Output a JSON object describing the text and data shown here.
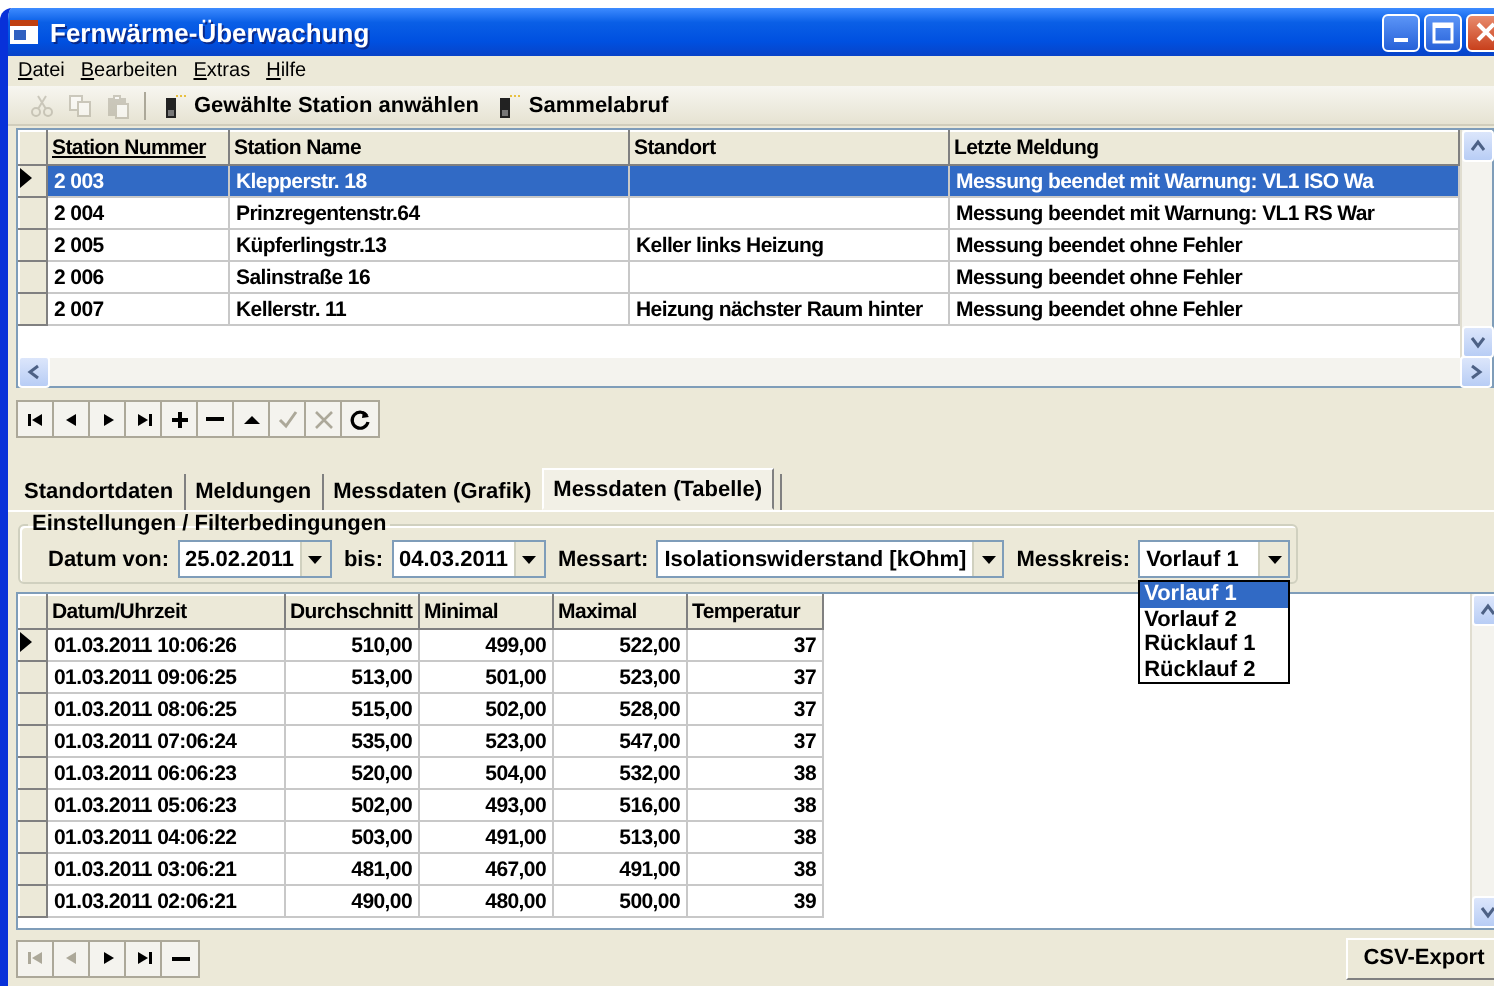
{
  "window": {
    "title": "Fernwärme-Überwachung"
  },
  "menu": [
    "Datei",
    "Bearbeiten",
    "Extras",
    "Hilfe"
  ],
  "toolbar": {
    "edit_buttons": [
      {
        "kind": "cut",
        "disabled": true
      },
      {
        "kind": "copy",
        "disabled": true
      },
      {
        "kind": "paste",
        "disabled": true
      }
    ],
    "buttons": [
      "Gewählte Station anwählen",
      "Sammelabruf"
    ]
  },
  "stations": {
    "columns": [
      "Station Nummer",
      "Station Name",
      "Standort",
      "Letzte Meldung"
    ],
    "rows": [
      {
        "cells": [
          "2 003",
          "Klepperstr. 18",
          "",
          "Messung beendet mit Warnung:  VL1 ISO Wa"
        ],
        "selected": true
      },
      {
        "cells": [
          "2 004",
          "Prinzregentenstr.64",
          "",
          "Messung beendet mit Warnung:  VL1 RS War"
        ],
        "selected": false
      },
      {
        "cells": [
          "2 005",
          "Küpferlingstr.13",
          "Keller links Heizung",
          "Messung beendet ohne Fehler"
        ],
        "selected": false
      },
      {
        "cells": [
          "2 006",
          "Salinstraße 16",
          "",
          "Messung beendet ohne Fehler"
        ],
        "selected": false
      },
      {
        "cells": [
          "2 007",
          "Kellerstr. 11",
          "Heizung nächster Raum hinter",
          "Messung beendet ohne Fehler"
        ],
        "selected": false
      }
    ]
  },
  "station_navigator": [
    {
      "kind": "first",
      "disabled": false
    },
    {
      "kind": "prev",
      "disabled": false
    },
    {
      "kind": "next",
      "disabled": false
    },
    {
      "kind": "last",
      "disabled": false
    },
    {
      "kind": "plus",
      "disabled": false
    },
    {
      "kind": "minus",
      "disabled": false
    },
    {
      "kind": "up",
      "disabled": false
    },
    {
      "kind": "check",
      "disabled": true
    },
    {
      "kind": "cancel",
      "disabled": true
    },
    {
      "kind": "refresh",
      "disabled": false
    }
  ],
  "tabs": [
    {
      "label": "Standortdaten",
      "selected": false
    },
    {
      "label": "Meldungen",
      "selected": false
    },
    {
      "label": "Messdaten (Grafik)",
      "selected": false
    },
    {
      "label": "Messdaten (Tabelle)",
      "selected": true
    }
  ],
  "filter": {
    "title": "Einstellungen / Filterbedingungen",
    "fields": [
      {
        "label": "Datum von:",
        "value": "25.02.2011"
      },
      {
        "label": "bis:",
        "value": "04.03.2011"
      },
      {
        "label": "Messart:",
        "value": "Isolationswiderstand [kOhm]"
      },
      {
        "label": "Messkreis:",
        "value": "Vorlauf 1",
        "options": [
          {
            "label": "Vorlauf 1",
            "selected": true
          },
          {
            "label": "Vorlauf 2",
            "selected": false
          },
          {
            "label": "Rücklauf 1",
            "selected": false
          },
          {
            "label": "Rücklauf 2",
            "selected": false
          }
        ]
      }
    ]
  },
  "measurements": {
    "columns": [
      "Datum/Uhrzeit",
      "Durchschnitt",
      "Minimal",
      "Maximal",
      "Temperatur"
    ],
    "rows": [
      {
        "cells": [
          "01.03.2011 10:06:26",
          "510,00",
          "499,00",
          "522,00",
          "37"
        ],
        "current": true
      },
      {
        "cells": [
          "01.03.2011 09:06:25",
          "513,00",
          "501,00",
          "523,00",
          "37"
        ],
        "current": false
      },
      {
        "cells": [
          "01.03.2011 08:06:25",
          "515,00",
          "502,00",
          "528,00",
          "37"
        ],
        "current": false
      },
      {
        "cells": [
          "01.03.2011 07:06:24",
          "535,00",
          "523,00",
          "547,00",
          "37"
        ],
        "current": false
      },
      {
        "cells": [
          "01.03.2011 06:06:23",
          "520,00",
          "504,00",
          "532,00",
          "38"
        ],
        "current": false
      },
      {
        "cells": [
          "01.03.2011 05:06:23",
          "502,00",
          "493,00",
          "516,00",
          "38"
        ],
        "current": false
      },
      {
        "cells": [
          "01.03.2011 04:06:22",
          "503,00",
          "491,00",
          "513,00",
          "38"
        ],
        "current": false
      },
      {
        "cells": [
          "01.03.2011 03:06:21",
          "481,00",
          "467,00",
          "491,00",
          "38"
        ],
        "current": false
      },
      {
        "cells": [
          "01.03.2011 02:06:21",
          "490,00",
          "480,00",
          "500,00",
          "39"
        ],
        "current": false
      }
    ]
  },
  "record_navigator": [
    {
      "kind": "first",
      "disabled": true
    },
    {
      "kind": "prev",
      "disabled": true
    },
    {
      "kind": "next",
      "disabled": false
    },
    {
      "kind": "last",
      "disabled": false
    },
    {
      "kind": "minus",
      "disabled": false
    }
  ],
  "export_button": "CSV-Export"
}
